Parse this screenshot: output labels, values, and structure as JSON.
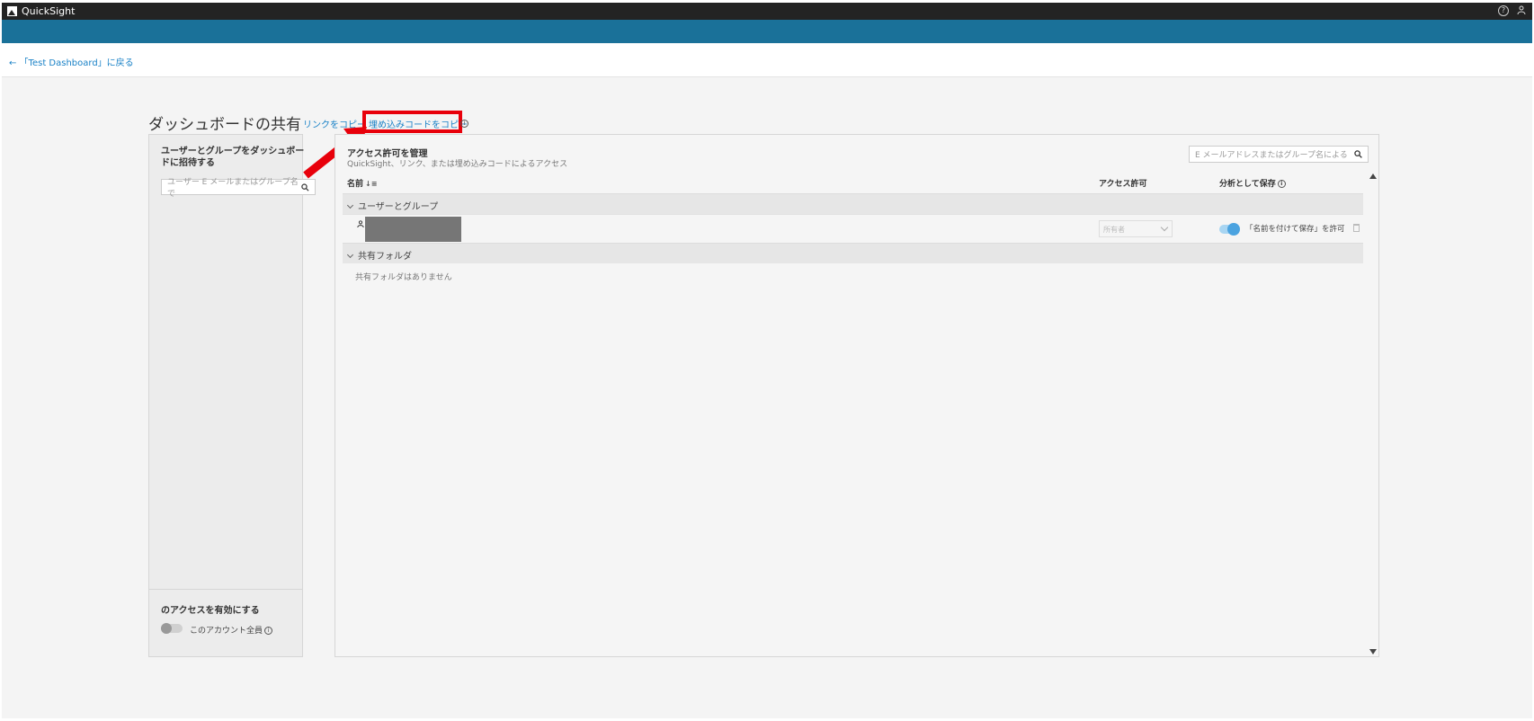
{
  "header": {
    "app_title": "QuickSight",
    "help_icon": "?",
    "user_icon": "user-icon"
  },
  "nav": {
    "back_link": "← 「Test Dashboard」に戻る"
  },
  "share": {
    "title": "ダッシュボードの共有",
    "copy_link": "リンクをコピー",
    "copy_embed": "埋め込みコードをコピー"
  },
  "left_panel": {
    "invite_title": "ユーザーとグループをダッシュボードに招待する",
    "search_placeholder": "ユーザー E メールまたはグループ名で",
    "enable_access_title": "のアクセスを有効にする",
    "all_account_label": "このアカウント全員"
  },
  "main_panel": {
    "manage_title": "アクセス許可を管理",
    "manage_subtitle": "QuickSight、リンク、または埋め込みコードによるアクセス",
    "search_placeholder": "E メールアドレスまたはグループ名による",
    "columns": {
      "name": "名前",
      "permission": "アクセス許可",
      "save_as_analysis": "分析として保存"
    },
    "groups": {
      "users_groups": "ユーザーとグループ",
      "shared_folders": "共有フォルダ"
    },
    "user_row": {
      "permission": "所有者",
      "save_as_label": "「名前を付けて保存」を許可",
      "save_as_enabled": true
    },
    "empty_folders": "共有フォルダはありません"
  },
  "colors": {
    "topbar": "#232323",
    "bluebar": "#1a7199",
    "link": "#1a82c7",
    "highlight_box": "#e8000b",
    "toggle_on": "#4ba3e0"
  }
}
